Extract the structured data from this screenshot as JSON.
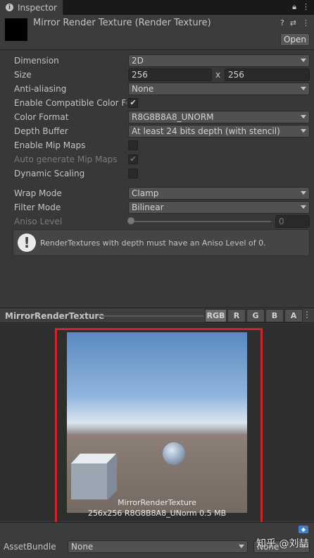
{
  "tab": {
    "icon": "info-icon",
    "label": "Inspector"
  },
  "header": {
    "title": "Mirror Render Texture (Render Texture)",
    "open_label": "Open"
  },
  "props": {
    "dimension": {
      "label": "Dimension",
      "value": "2D"
    },
    "size": {
      "label": "Size",
      "width": "256",
      "sep": "x",
      "height": "256"
    },
    "anti_aliasing": {
      "label": "Anti-aliasing",
      "value": "None"
    },
    "enable_compat": {
      "label": "Enable Compatible Color For",
      "checked": true,
      "mark": "✔"
    },
    "color_format": {
      "label": "Color Format",
      "value": "R8G8B8A8_UNORM"
    },
    "depth_buffer": {
      "label": "Depth Buffer",
      "value": "At least 24 bits depth (with stencil)"
    },
    "enable_mip": {
      "label": "Enable Mip Maps",
      "checked": false
    },
    "auto_mip": {
      "label": "Auto generate Mip Maps",
      "checked": true,
      "disabled": true,
      "mark": "✔"
    },
    "dynamic_scaling": {
      "label": "Dynamic Scaling",
      "checked": false
    },
    "wrap_mode": {
      "label": "Wrap Mode",
      "value": "Clamp"
    },
    "filter_mode": {
      "label": "Filter Mode",
      "value": "Bilinear"
    },
    "aniso_level": {
      "label": "Aniso Level",
      "value": "0",
      "disabled": true
    }
  },
  "help": {
    "icon": "warning-icon",
    "text": "RenderTextures with depth must have an Aniso Level of 0."
  },
  "preview": {
    "name": "MirrorRenderTexture",
    "channels": [
      "RGB",
      "R",
      "G",
      "B",
      "A"
    ],
    "caption_name": "MirrorRenderTexture",
    "caption_info": "256x256  R8G8B8A8_UNorm  0.5 MB"
  },
  "asset_bundle": {
    "label": "AssetBundle",
    "value": "None",
    "variant": "None"
  },
  "watermark": "知乎 @刘喆"
}
